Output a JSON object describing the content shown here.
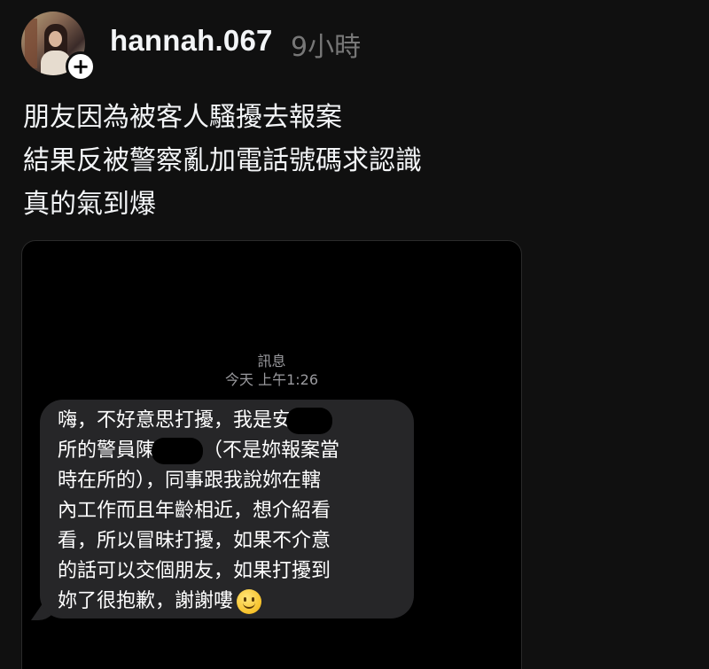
{
  "post": {
    "username": "hannah.067",
    "time": "9小時",
    "follow_symbol": "+",
    "caption_lines": [
      "朋友因為被客人騷擾去報案",
      "結果反被警察亂加電話號碼求認識",
      "真的氣到爆"
    ]
  },
  "screenshot": {
    "label": "訊息",
    "time": "今天 上午1:26",
    "message_lines": [
      "嗨，不好意思打擾，我是安",
      "所的警員陳",
      "（不是妳報案當",
      "時在所的），同事跟我說妳在轄",
      "內工作而且年齡相近，想介紹看",
      "看，所以冒昧打擾，如果不介意",
      "的話可以交個朋友，如果打擾到",
      "妳了很抱歉，謝謝嘍"
    ],
    "emoji": "slightly-smiling-face"
  },
  "colors": {
    "background": "#101010",
    "text_primary": "#f3f5f7",
    "text_secondary": "#777777",
    "bubble": "#262628"
  }
}
